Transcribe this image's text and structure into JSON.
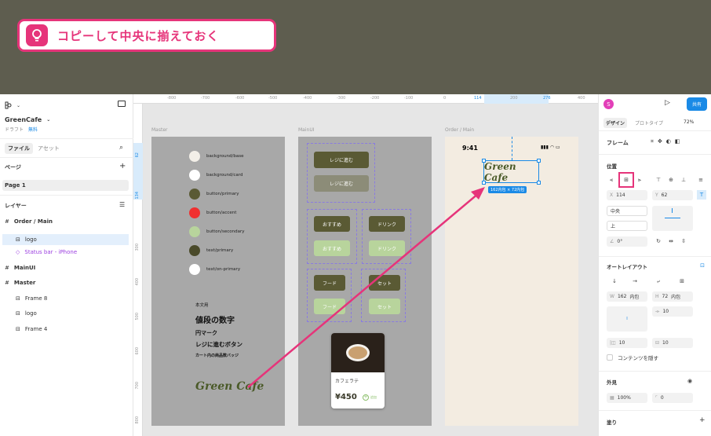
{
  "banner": {
    "text": "コピーして中央に揃えておく",
    "icon": "lightbulb-icon"
  },
  "file": {
    "name": "GreenCafe",
    "sub": "ドラフト",
    "plan": "無料",
    "tab_file": "ファイル",
    "tab_assets": "アセット"
  },
  "pages": {
    "title": "ページ",
    "items": [
      "Page 1"
    ]
  },
  "layers": {
    "title": "レイヤー",
    "items": [
      {
        "label": "Order / Main",
        "indent": 0
      },
      {
        "label": "logo",
        "indent": 1
      },
      {
        "label": "Status bar - iPhone",
        "indent": 1
      },
      {
        "label": "MainUI",
        "indent": 0
      },
      {
        "label": "Master",
        "indent": 0
      },
      {
        "label": "Frame 8",
        "indent": 1
      },
      {
        "label": "logo",
        "indent": 1
      },
      {
        "label": "Frame 4",
        "indent": 1
      }
    ]
  },
  "ruler": {
    "h": [
      "-800",
      "-700",
      "-600",
      "-500",
      "-400",
      "-300",
      "-200",
      "-100",
      "0",
      "114",
      "200",
      "276",
      "400"
    ],
    "v": [
      "62",
      "134",
      "300",
      "400",
      "500",
      "600",
      "700",
      "800"
    ]
  },
  "frames": {
    "master": "Master",
    "mainui": "MainUI",
    "order": "Order / Main"
  },
  "master": {
    "colors": [
      {
        "name": "background/base",
        "color": "#f3efe8"
      },
      {
        "name": "background/card",
        "color": "#ffffff"
      },
      {
        "name": "button/primary",
        "color": "#5a5a34"
      },
      {
        "name": "button/accent",
        "color": "#f03030"
      },
      {
        "name": "button/secondary",
        "color": "#b8d49c"
      },
      {
        "name": "text/primary",
        "color": "#4a4a2a"
      },
      {
        "name": "text/on-primary",
        "color": "#ffffff"
      }
    ],
    "type": [
      "本文用",
      "値段の数字",
      "円マーク",
      "レジに進むボタン",
      "カート内の商品数バッジ"
    ],
    "logo": "Green Cafe"
  },
  "mainui": {
    "register1": "レジに進む",
    "register2": "レジに進む",
    "rec1": "おすすめ",
    "rec2": "おすすめ",
    "drink1": "ドリンク",
    "drink2": "ドリンク",
    "food1": "フード",
    "food2": "フード",
    "set1": "セット",
    "set2": "セット",
    "card": {
      "name": "カフェラテ",
      "price": "¥450",
      "add": "追加"
    }
  },
  "order": {
    "time": "9:41",
    "logo": "Green Cafe",
    "size": "162内包 × 72内包"
  },
  "right": {
    "avatar": "S",
    "share": "共有",
    "tab_design": "デザイン",
    "tab_proto": "プロトタイプ",
    "zoom": "72%",
    "frame": "フレーム",
    "position": "位置",
    "x_label": "X",
    "x": "114",
    "y_label": "Y",
    "y": "62",
    "h_constraint": "中央",
    "v_constraint": "上",
    "rotation": "0°",
    "autolayout": "オートレイアウト",
    "w_label": "W",
    "w": "162",
    "w_mode": "内包",
    "h_label": "H",
    "h": "72",
    "h_mode": "内包",
    "gap": "10",
    "pad_h": "10",
    "pad_v": "10",
    "clip": "コンテンツを隠す",
    "appearance": "外見",
    "opacity": "100%",
    "radius": "0",
    "fill": "塗り"
  }
}
